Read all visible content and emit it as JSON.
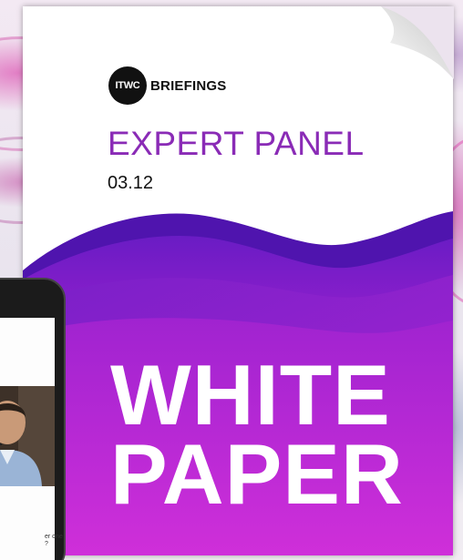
{
  "document": {
    "logo_badge": "ITWC",
    "logo_word": "BRIEFINGS",
    "title": "EXPERT PANEL",
    "date": "03.12",
    "headline_line1": "WHITE",
    "headline_line2": "PAPER"
  },
  "phone": {
    "caption": "er one\n?"
  },
  "colors": {
    "title": "#8a2bb6",
    "wave_dark": "#5a18b8",
    "wave_mid": "#8a1ecf",
    "wave_light": "#c930d6",
    "headline": "#ffffff"
  }
}
